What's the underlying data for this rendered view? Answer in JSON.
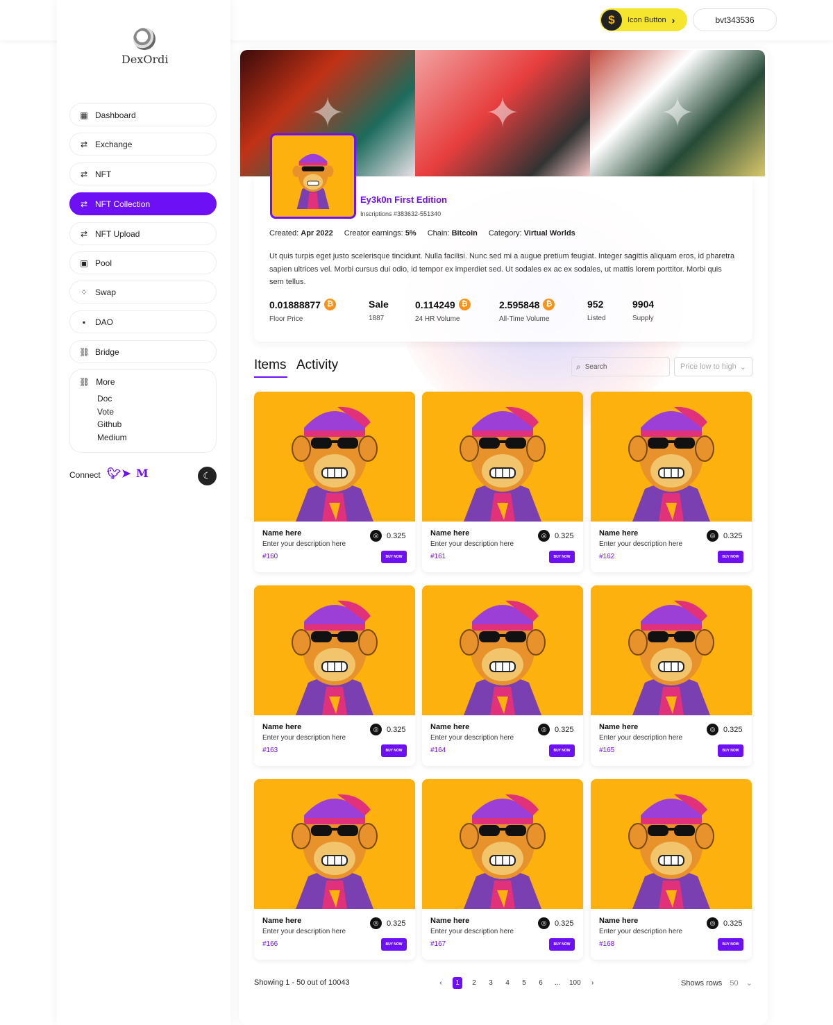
{
  "topbar": {
    "icon_button_label": "Icon Button",
    "account_label": "bvt343536"
  },
  "brand": {
    "name": "DexOrdi"
  },
  "nav": [
    {
      "label": "Dashboard",
      "icon": "dashboard-icon",
      "glyph": "▦"
    },
    {
      "label": "Exchange",
      "icon": "exchange-icon",
      "glyph": "⇄"
    },
    {
      "label": "NFT",
      "icon": "swap-arrows-icon",
      "glyph": "⇄"
    },
    {
      "label": "NFT Collection",
      "icon": "swap-arrows-icon",
      "glyph": "⇄",
      "active": true
    },
    {
      "label": "NFT Upload",
      "icon": "swap-arrows-icon",
      "glyph": "⇄"
    },
    {
      "label": "Pool",
      "icon": "pool-icon",
      "glyph": "▣"
    },
    {
      "label": "Swap",
      "icon": "swap-icon",
      "glyph": "⁘"
    },
    {
      "label": "DAO",
      "icon": "dao-icon",
      "glyph": "▪"
    },
    {
      "label": "Bridge",
      "icon": "link-icon",
      "glyph": "⛓"
    }
  ],
  "more": {
    "label": "More",
    "items": [
      "Doc",
      "Vote",
      "Github",
      "Medium"
    ]
  },
  "connect": {
    "label": "Connect",
    "socials": [
      "twitter-icon",
      "telegram-icon",
      "medium-icon"
    ]
  },
  "collection": {
    "title": "Ey3k0n First Edition",
    "inscriptions": "Inscriptions #383632-551340",
    "meta": [
      {
        "k": "Created:",
        "v": "Apr 2022"
      },
      {
        "k": "Creator earnings:",
        "v": "5%"
      },
      {
        "k": "Chain:",
        "v": "Bitcoin"
      },
      {
        "k": "Category:",
        "v": "Virtual Worlds"
      }
    ],
    "description": "Ut quis turpis eget justo scelerisque tincidunt. Nulla facilisi. Nunc sed mi a augue pretium feugiat. Integer sagittis aliquam eros, id pharetra sapien ultrices vel. Morbi cursus dui odio, id tempor ex imperdiet sed. Ut sodales ex ac ex sodales, ut mattis lorem porttitor. Morbi quis sem tellus.",
    "stats": [
      {
        "value": "0.01888877",
        "label": "Floor Price",
        "btc": true
      },
      {
        "value": "Sale",
        "label": "1887",
        "btc": false
      },
      {
        "value": "0.114249",
        "label": "24 HR Volume",
        "btc": true
      },
      {
        "value": "2.595848",
        "label": "All-Time Volume",
        "btc": true
      },
      {
        "value": "952",
        "label": "Listed",
        "btc": false
      },
      {
        "value": "9904",
        "label": "Supply",
        "btc": false
      }
    ]
  },
  "tabs": [
    "Items",
    "Activity"
  ],
  "search": {
    "placeholder": "Search"
  },
  "sort": {
    "selected": "Price low to high"
  },
  "items": [
    {
      "name": "Name here",
      "desc": "Enter your description here",
      "id": "#160",
      "price": "0.325",
      "button": "BUY NOW"
    },
    {
      "name": "Name here",
      "desc": "Enter your description here",
      "id": "#161",
      "price": "0.325",
      "button": "BUY NOW"
    },
    {
      "name": "Name here",
      "desc": "Enter your description here",
      "id": "#162",
      "price": "0.325",
      "button": "BUY NOW"
    },
    {
      "name": "Name here",
      "desc": "Enter your description here",
      "id": "#163",
      "price": "0.325",
      "button": "BUY NOW"
    },
    {
      "name": "Name here",
      "desc": "Enter your description here",
      "id": "#164",
      "price": "0.325",
      "button": "BUY NOW"
    },
    {
      "name": "Name here",
      "desc": "Enter your description here",
      "id": "#165",
      "price": "0.325",
      "button": "BUY NOW"
    },
    {
      "name": "Name here",
      "desc": "Enter your description here",
      "id": "#166",
      "price": "0.325",
      "button": "BUY NOW"
    },
    {
      "name": "Name here",
      "desc": "Enter your description here",
      "id": "#167",
      "price": "0.325",
      "button": "BUY NOW"
    },
    {
      "name": "Name here",
      "desc": "Enter your description here",
      "id": "#168",
      "price": "0.325",
      "button": "BUY NOW"
    }
  ],
  "pagination": {
    "summary": "Showing 1 - 50 out of 10043",
    "pages": [
      "1",
      "2",
      "3",
      "4",
      "5",
      "6",
      "...",
      "100"
    ],
    "current": "1",
    "rows_label": "Shows rows",
    "rows_value": "50"
  },
  "colors": {
    "accent": "#6d10f5",
    "card_bg": "#fcb10d",
    "icon_button": "#f5e52c"
  }
}
